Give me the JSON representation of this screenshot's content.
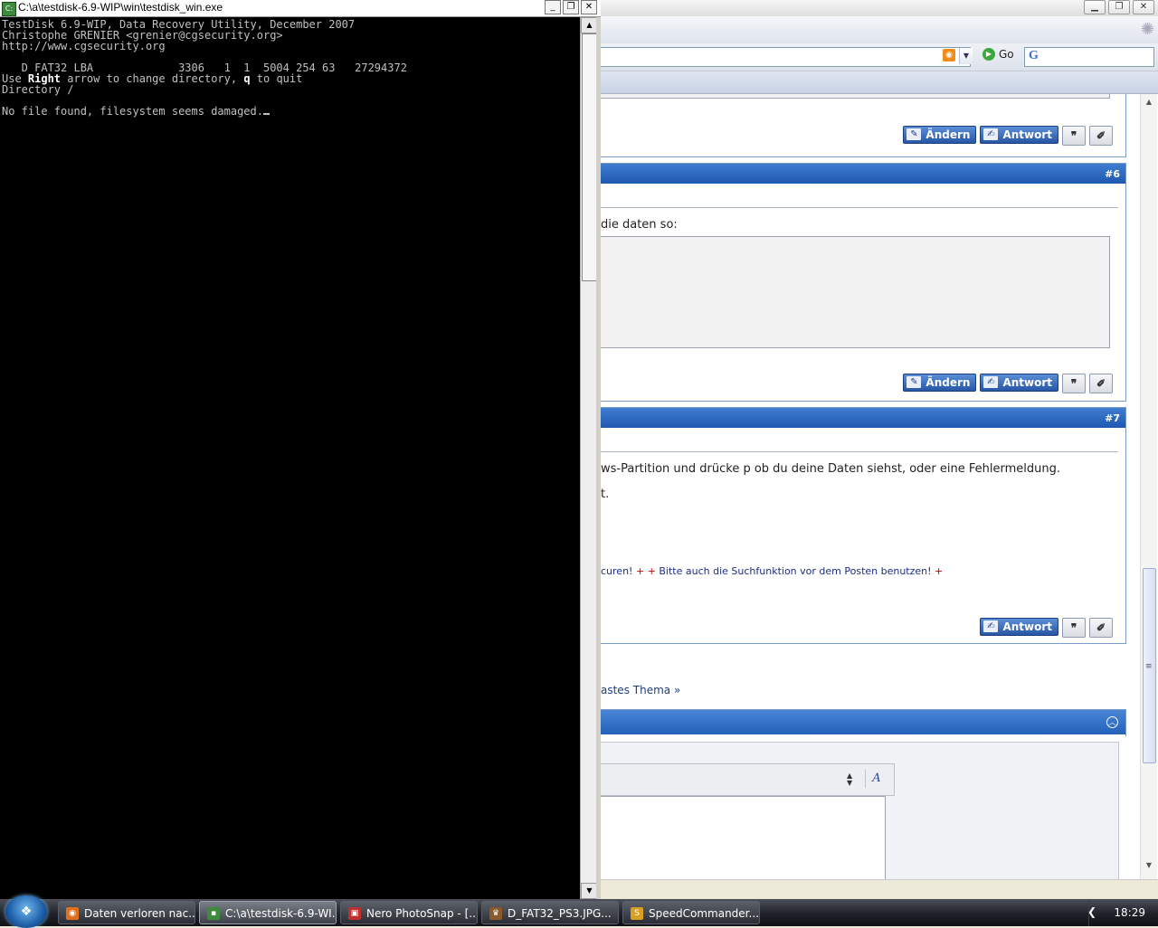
{
  "console": {
    "title": "C:\\a\\testdisk-6.9-WIP\\win\\testdisk_win.exe",
    "line1": "TestDisk 6.9-WIP, Data Recovery Utility, December 2007",
    "line2": "Christophe GRENIER <grenier@cgsecurity.org>",
    "line3": "http://www.cgsecurity.org",
    "partition_line": "   D FAT32 LBA             3306   1  1  5004 254 63   27294372",
    "hint_prefix": "Use ",
    "hint_key1": "Right",
    "hint_mid": " arrow to change directory, ",
    "hint_key2": "q",
    "hint_suffix": " to quit",
    "directory_line": "Directory /",
    "message": "No file found, filesystem seems damaged."
  },
  "browser": {
    "go_label": "Go",
    "post5": {
      "btn_andern": "Ändern",
      "btn_antwort": "Antwort"
    },
    "post6": {
      "number": "#6",
      "text": "die daten so:",
      "btn_andern": "Ändern",
      "btn_antwort": "Antwort"
    },
    "post7": {
      "number": "#7",
      "text1": "ws-Partition und drücke p ob du deine Daten siehst, oder eine Fehlermeldung.",
      "text2": "t.",
      "sig_part1": "curen!",
      "sig_plus": "+",
      "sig_part2": "Bitte auch die Suchfunktion vor dem Posten benutzen!",
      "btn_antwort": "Antwort"
    },
    "next_topic": "astes Thema",
    "next_arrow": "»"
  },
  "taskbar": {
    "tasks": [
      {
        "label": "Daten verloren nac...",
        "icon": "firefox-icon",
        "color": "#e07020"
      },
      {
        "label": "C:\\a\\testdisk-6.9-WI...",
        "icon": "console-icon",
        "color": "#3d8b3d"
      },
      {
        "label": "Nero PhotoSnap - [...",
        "icon": "nero-icon",
        "color": "#c03030"
      },
      {
        "label": "D_FAT32_PS3.JPG...",
        "icon": "image-viewer-icon",
        "color": "#8a5a2a"
      },
      {
        "label": "SpeedCommander...",
        "icon": "speedcommander-icon",
        "color": "#d8a020"
      }
    ],
    "clock": "18:29"
  }
}
